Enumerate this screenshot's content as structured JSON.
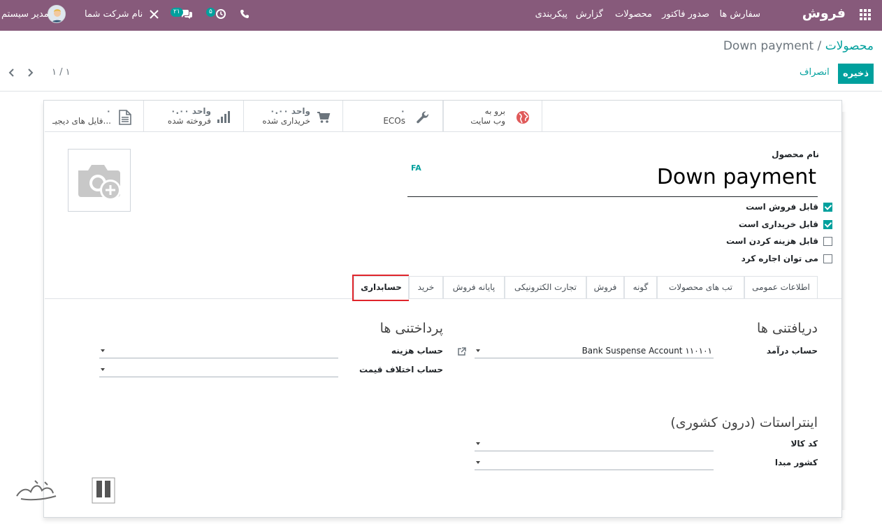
{
  "navbar": {
    "brand": "فروش",
    "menu": [
      "سفارش ها",
      "صدور فاکتور",
      "محصولات",
      "گزارش",
      "پیکربندی"
    ],
    "activity_count": "۵",
    "messages_count": "۲۱",
    "company": "نام شرکت شما",
    "user": "مدیر سیستم"
  },
  "breadcrumb": {
    "parent": "محصولات",
    "separator": " / ",
    "current": "Down payment"
  },
  "actions": {
    "save": "ذخیره",
    "discard": "انصراف"
  },
  "pager": {
    "value": "۱ / ۱"
  },
  "smart_buttons": [
    {
      "icon": "globe-icon",
      "line1": "برو به",
      "line2": "وب سایت"
    },
    {
      "icon": "wrench-icon",
      "line1": "۰",
      "line2": "ECOs"
    },
    {
      "icon": "cart-icon",
      "line1": "۰.۰۰ واحد",
      "line2": "خریداری شده"
    },
    {
      "icon": "bar-chart-icon",
      "line1": "۰.۰۰ واحد",
      "line2": "فروخته شده"
    },
    {
      "icon": "document-icon",
      "line1": "۰",
      "line2": "فایل های دیجیـ..."
    }
  ],
  "product": {
    "name_label": "نام محصول",
    "name": "Down payment",
    "lang": "FA"
  },
  "checkboxes": [
    {
      "label": "قابل فروش است",
      "checked": true
    },
    {
      "label": "قابل خریداری است",
      "checked": true
    },
    {
      "label": "قابل هزینه کردن است",
      "checked": false
    },
    {
      "label": "می توان اجاره کرد",
      "checked": false
    }
  ],
  "tabs": [
    "اطلاعات عمومی",
    "تب های محصولات",
    "گونه",
    "فروش",
    "تجارت الکترونیکی",
    "پایانه فروش",
    "خرید",
    "حسابداری"
  ],
  "accounting": {
    "receivables": {
      "title": "دریافتنی ها",
      "income_label": "حساب درآمد",
      "income_value": "Bank Suspense Account ۱۱۰۱۰۱"
    },
    "payables": {
      "title": "پرداختنی ها",
      "expense_label": "حساب هزینه",
      "price_diff_label": "حساب اختلاف قیمت"
    },
    "intrastat": {
      "title": "اینتراستات (درون کشوری)",
      "commodity_label": "کد کالا",
      "origin_label": "کشور مبدا"
    }
  }
}
